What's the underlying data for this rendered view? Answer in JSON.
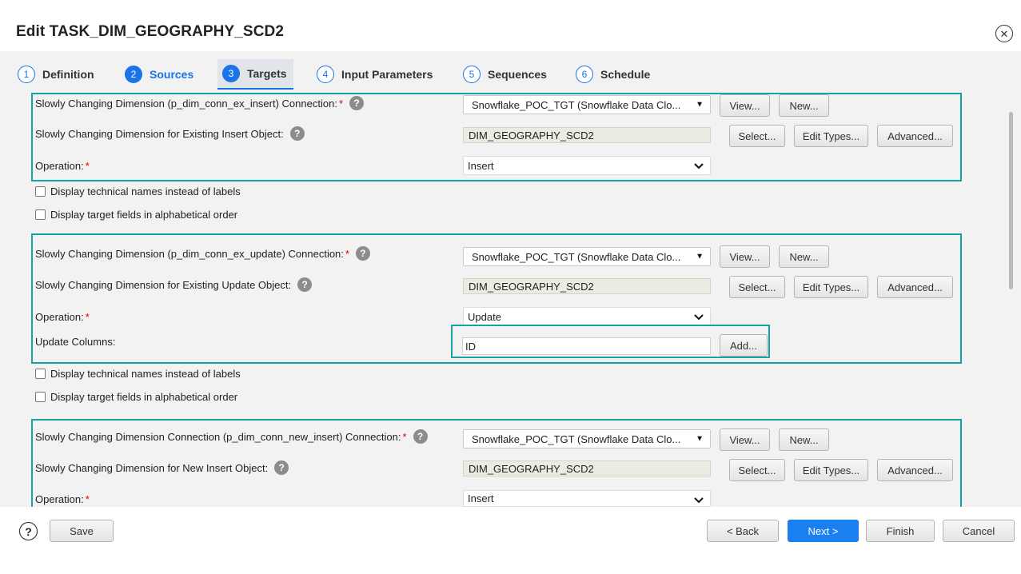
{
  "window": {
    "title": "Edit TASK_DIM_GEOGRAPHY_SCD2"
  },
  "tabs": [
    {
      "num": "1",
      "label": "Definition"
    },
    {
      "num": "2",
      "label": "Sources"
    },
    {
      "num": "3",
      "label": "Targets"
    },
    {
      "num": "4",
      "label": "Input Parameters"
    },
    {
      "num": "5",
      "label": "Sequences"
    },
    {
      "num": "6",
      "label": "Schedule"
    }
  ],
  "section1": {
    "connection_label": "Slowly Changing Dimension (p_dim_conn_ex_insert) Connection:",
    "connection_value": "Snowflake_POC_TGT (Snowflake Data Clo...",
    "object_label": "Slowly Changing Dimension for Existing Insert Object:",
    "object_value": "DIM_GEOGRAPHY_SCD2",
    "operation_label": "Operation:",
    "operation_value": "Insert"
  },
  "section2": {
    "connection_label": "Slowly Changing Dimension (p_dim_conn_ex_update) Connection:",
    "connection_value": "Snowflake_POC_TGT (Snowflake Data Clo...",
    "object_label": "Slowly Changing Dimension for Existing Update Object:",
    "object_value": "DIM_GEOGRAPHY_SCD2",
    "operation_label": "Operation:",
    "operation_value": "Update",
    "update_columns_label": "Update Columns:",
    "update_columns_value": "ID"
  },
  "section3": {
    "connection_label": "Slowly Changing Dimension Connection (p_dim_conn_new_insert) Connection:",
    "connection_value": "Snowflake_POC_TGT (Snowflake Data Clo...",
    "object_label": "Slowly Changing Dimension for New Insert Object:",
    "object_value": "DIM_GEOGRAPHY_SCD2",
    "operation_label": "Operation:",
    "operation_value": "Insert"
  },
  "options": {
    "technical_names": "Display technical names instead of labels",
    "alphabetical": "Display target fields in alphabetical order"
  },
  "buttons": {
    "view": "View...",
    "new": "New...",
    "select": "Select...",
    "edit_types": "Edit Types...",
    "advanced": "Advanced...",
    "add": "Add..."
  },
  "required_mark": "*",
  "help_glyph": "?",
  "footer": {
    "help": "?",
    "save": "Save",
    "back": "< Back",
    "next": "Next >",
    "finish": "Finish",
    "cancel": "Cancel"
  },
  "colors": {
    "accent": "#1a73e8",
    "highlight": "#17a3a3",
    "required": "#dd0000",
    "panel_bg": "#f2f2f2"
  },
  "icons": {
    "close": "close-circle-icon",
    "help": "question-circle-icon",
    "dropdown": "triangle-down-icon",
    "chevron": "chevron-down-icon"
  }
}
